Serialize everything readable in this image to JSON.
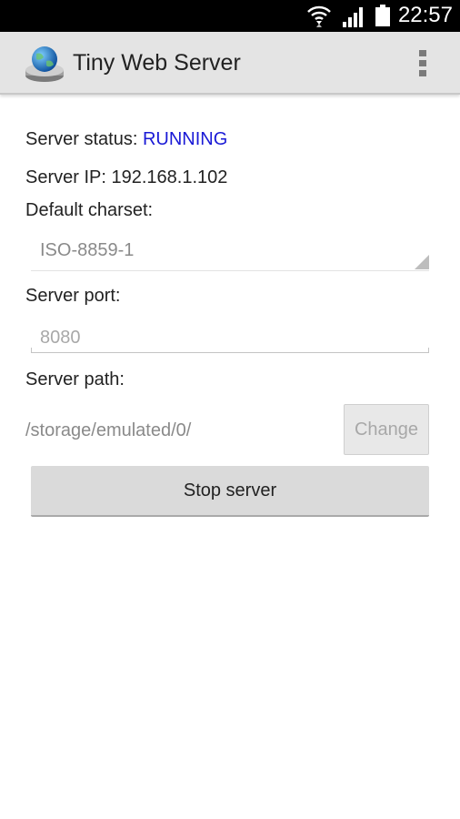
{
  "status_bar": {
    "time": "22:57",
    "icons": [
      "wifi-icon",
      "cell-signal-icon",
      "battery-icon"
    ]
  },
  "action_bar": {
    "title": "Tiny Web Server",
    "app_icon": "server-globe-icon",
    "overflow_icon": "overflow-menu-icon"
  },
  "form": {
    "status_label": "Server status:",
    "status_value": "RUNNING",
    "ip_label": "Server IP:",
    "ip_value": "192.168.1.102",
    "charset_label": "Default charset:",
    "charset_value": "ISO-8859-1",
    "port_label": "Server port:",
    "port_placeholder": "8080",
    "path_label": "Server path:",
    "path_value": "/storage/emulated/0/",
    "change_label": "Change",
    "stop_label": "Stop server"
  },
  "colors": {
    "running": "#1a1ad6",
    "action_bar_bg": "#e4e4e4",
    "status_bar_bg": "#000000"
  }
}
